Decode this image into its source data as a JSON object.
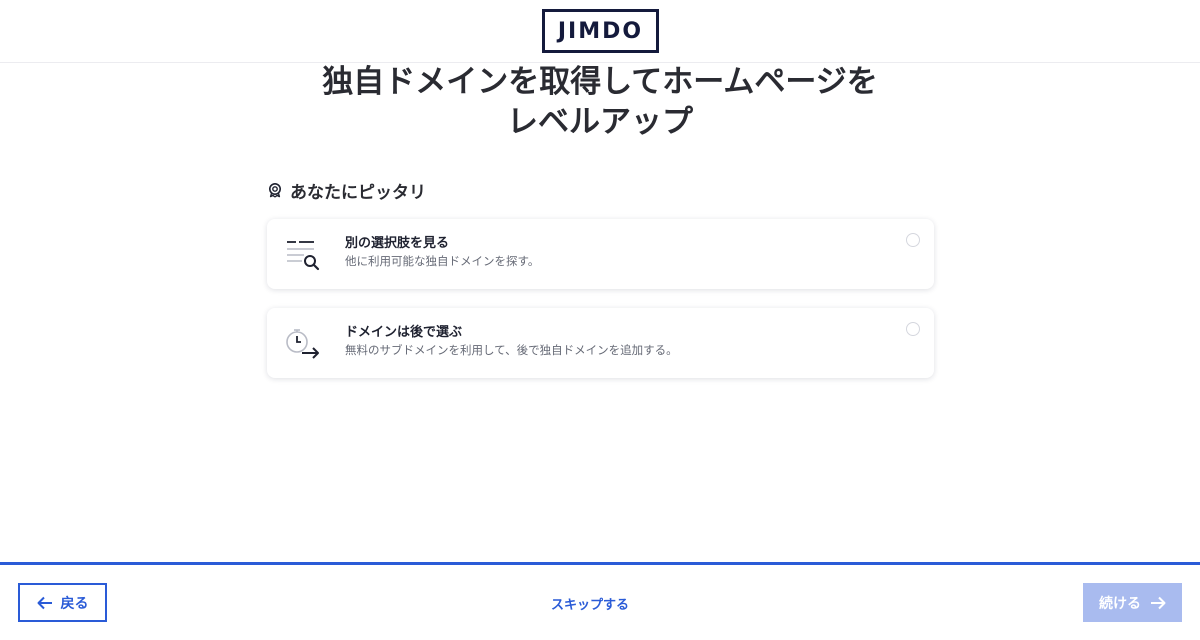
{
  "header": {
    "logo_text": "JIMDO"
  },
  "page": {
    "title_line1": "独自ドメインを取得してホームページを",
    "title_line2": "レベルアップ"
  },
  "section": {
    "label": "あなたにピッタリ",
    "icon": "badge-icon"
  },
  "options": [
    {
      "title": "別の選択肢を見る",
      "description": "他に利用可能な独自ドメインを探す。",
      "icon": "list-search-icon",
      "selected": false
    },
    {
      "title": "ドメインは後で選ぶ",
      "description": "無料のサブドメインを利用して、後で独自ドメインを追加する。",
      "icon": "stopwatch-arrow-icon",
      "selected": false
    }
  ],
  "progress": {
    "fraction": 1.0
  },
  "footer": {
    "back_label": "戻る",
    "skip_label": "スキップする",
    "next_label": "続ける",
    "next_enabled": false
  },
  "colors": {
    "accent": "#2a5bd7",
    "accent_disabled": "#a9bbef",
    "brand_dark": "#141a3c",
    "text": "#1f2230",
    "muted_text": "#666a76"
  }
}
